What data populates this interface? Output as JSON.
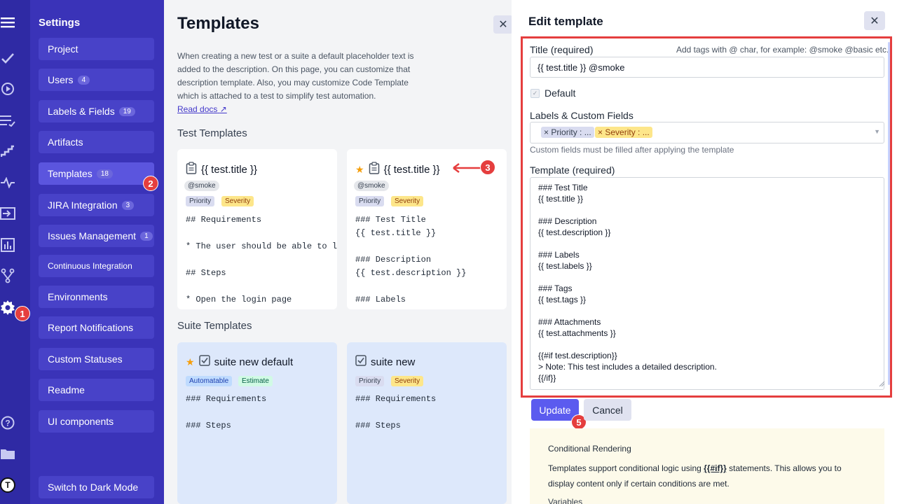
{
  "rail": {
    "icons": [
      "menu-icon",
      "check-icon",
      "play-icon",
      "list-icon",
      "stairs-icon",
      "pulse-icon",
      "import-icon",
      "chart-icon",
      "branch-icon",
      "gear-icon",
      "help-icon",
      "folder-icon",
      "avatar"
    ],
    "gear_marker": "1",
    "avatar_letter": "T"
  },
  "sidebar": {
    "title": "Settings",
    "items": [
      {
        "label": "Project",
        "count": ""
      },
      {
        "label": "Users",
        "count": "4"
      },
      {
        "label": "Labels & Fields",
        "count": "19"
      },
      {
        "label": "Artifacts",
        "count": ""
      },
      {
        "label": "Templates",
        "count": "18"
      },
      {
        "label": "JIRA Integration",
        "count": "3"
      },
      {
        "label": "Issues Management",
        "count": "1"
      },
      {
        "label": "Continuous Integration",
        "count": ""
      },
      {
        "label": "Environments",
        "count": ""
      },
      {
        "label": "Report Notifications",
        "count": ""
      },
      {
        "label": "Custom Statuses",
        "count": ""
      },
      {
        "label": "Readme",
        "count": ""
      },
      {
        "label": "UI components",
        "count": ""
      }
    ],
    "templates_marker": "2",
    "dark_mode": "Switch to Dark Mode"
  },
  "main": {
    "title": "Templates",
    "description": "When creating a new test or a suite a default placeholder text is added to the description. On this page, you can customize that description template. Also, you may customize Code Template which is attached to a test to simplify test automation.",
    "read_docs": "Read docs",
    "test_heading": "Test Templates",
    "suite_heading": "Suite Templates",
    "test_cards": [
      {
        "title": "{{ test.title }}",
        "tag": "@smoke",
        "badges": [
          "Priority",
          "Severity"
        ],
        "code": "## Requirements\n\n* The user should be able to log\n\n## Steps\n\n* Open the login page"
      },
      {
        "title": "{{ test.title }}",
        "tag": "@smoke",
        "badges": [
          "Priority",
          "Severity"
        ],
        "code": "### Test Title\n{{ test.title }}\n\n### Description\n{{ test.description }}\n\n### Labels"
      }
    ],
    "card_marker": "3",
    "suite_cards": [
      {
        "title": "suite new default",
        "badges": [
          "Automatable",
          "Estimate"
        ],
        "code": "### Requirements\n\n### Steps"
      },
      {
        "title": "suite new",
        "badges": [
          "Priority",
          "Severity"
        ],
        "code": "### Requirements\n\n### Steps"
      }
    ]
  },
  "panel": {
    "title": "Edit template",
    "title_label": "Title (required)",
    "tags_hint": "Add tags with @ char, for example: @smoke @basic etc.",
    "title_value": "{{ test.title }} @smoke",
    "default_label": "Default",
    "labels_label": "Labels & Custom Fields",
    "chips": [
      "Priority : ...",
      "Severity : ..."
    ],
    "fields_hint": "Custom fields must be filled after applying the template",
    "template_label": "Template (required)",
    "template_value": "### Test Title\n{{ test.title }}\n\n### Description\n{{ test.description }}\n\n### Labels\n{{ test.labels }}\n\n### Tags\n{{ test.tags }}\n\n### Attachments\n{{ test.attachments }}\n\n{{#if test.description}}\n> Note: This test includes a detailed description.\n{{/if}}",
    "update": "Update",
    "cancel": "Cancel",
    "update_marker": "5",
    "info_title": "Conditional Rendering",
    "info_text_pre": "Templates support conditional logic using ",
    "info_code": "{{#if}}",
    "info_text_post": " statements. This allows you to display content only if certain conditions are met.",
    "info_more": "Variables"
  },
  "colors": {
    "rail": "#2f2aa4",
    "sidebar": "#3a33b8",
    "accent": "#5b55de",
    "marker": "#e53e3e"
  }
}
